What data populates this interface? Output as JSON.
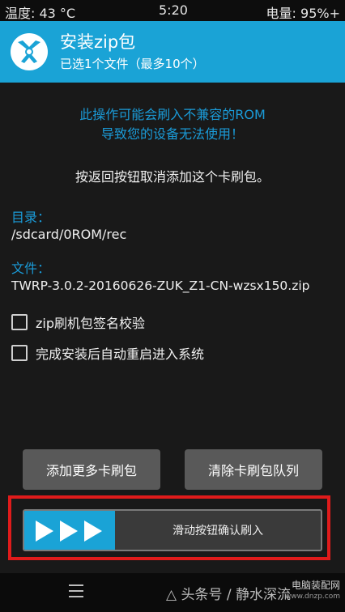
{
  "status_bar": {
    "temperature": "温度: 43 °C",
    "time": "5:20",
    "battery": "电量: 95%+"
  },
  "header": {
    "title": "安装zip包",
    "subtitle": "已选1个文件（最多10个）",
    "logo_icon": "twrp-logo-icon"
  },
  "warning": {
    "line1": "此操作可能会刷入不兼容的ROM",
    "line2": "导致您的设备无法使用！"
  },
  "info_text": "按返回按钮取消添加这个卡刷包。",
  "directory": {
    "label": "目录：",
    "value": "/sdcard/0ROM/rec"
  },
  "file": {
    "label": "文件：",
    "value": "TWRP-3.0.2-20160626-ZUK_Z1-CN-wzsx150.zip"
  },
  "options": [
    {
      "label": "zip刷机包签名校验",
      "checked": false
    },
    {
      "label": "完成安装后自动重启进入系统",
      "checked": false
    }
  ],
  "buttons": {
    "add_more": "添加更多卡刷包",
    "clear_queue": "清除卡刷包队列"
  },
  "slider": {
    "label": "滑动按钮确认刷入",
    "icon": "triple-arrow-right-icon"
  },
  "navbar": {
    "menu_icon": "menu-icon",
    "watermark": "△ 头条号 / 静水深流",
    "watermark_site": "电脑装配网",
    "watermark_url": "www.dnzp.com"
  },
  "colors": {
    "accent": "#1aa3d6",
    "warning_text": "#1a9bd8",
    "highlight_border": "#e01b1b",
    "button_bg": "#595959",
    "background": "#191919"
  }
}
